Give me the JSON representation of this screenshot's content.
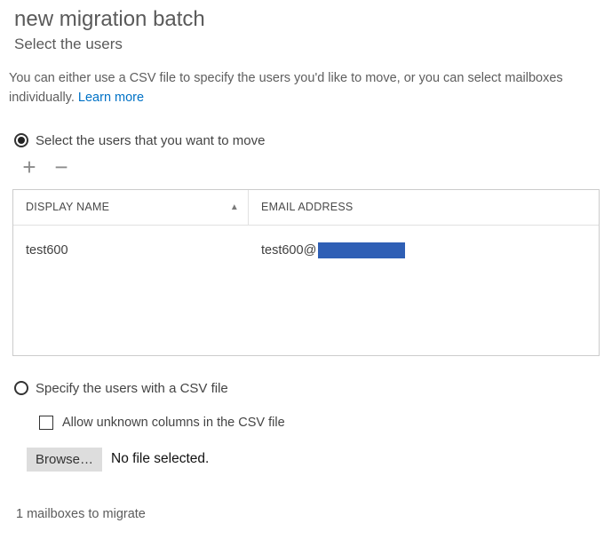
{
  "header": {
    "title": "new migration batch",
    "subtitle": "Select the users"
  },
  "intro": {
    "text_a": "You can either use a CSV file to specify the users you'd like to move, or you can select mailboxes individually. ",
    "learn_more": "Learn more"
  },
  "options": {
    "select_users_label": "Select the users that you want to move",
    "csv_label": "Specify the users with a CSV file"
  },
  "toolbar": {
    "add": "+",
    "remove": "−"
  },
  "grid": {
    "columns": {
      "display_name": "DISPLAY NAME",
      "email": "EMAIL ADDRESS"
    },
    "rows": [
      {
        "display_name": "test600",
        "email_prefix": "test600@"
      }
    ]
  },
  "csv": {
    "allow_unknown": "Allow unknown columns in the CSV file",
    "browse": "Browse…",
    "no_file": "No file selected."
  },
  "footer": {
    "count_text": "1 mailboxes to migrate"
  }
}
